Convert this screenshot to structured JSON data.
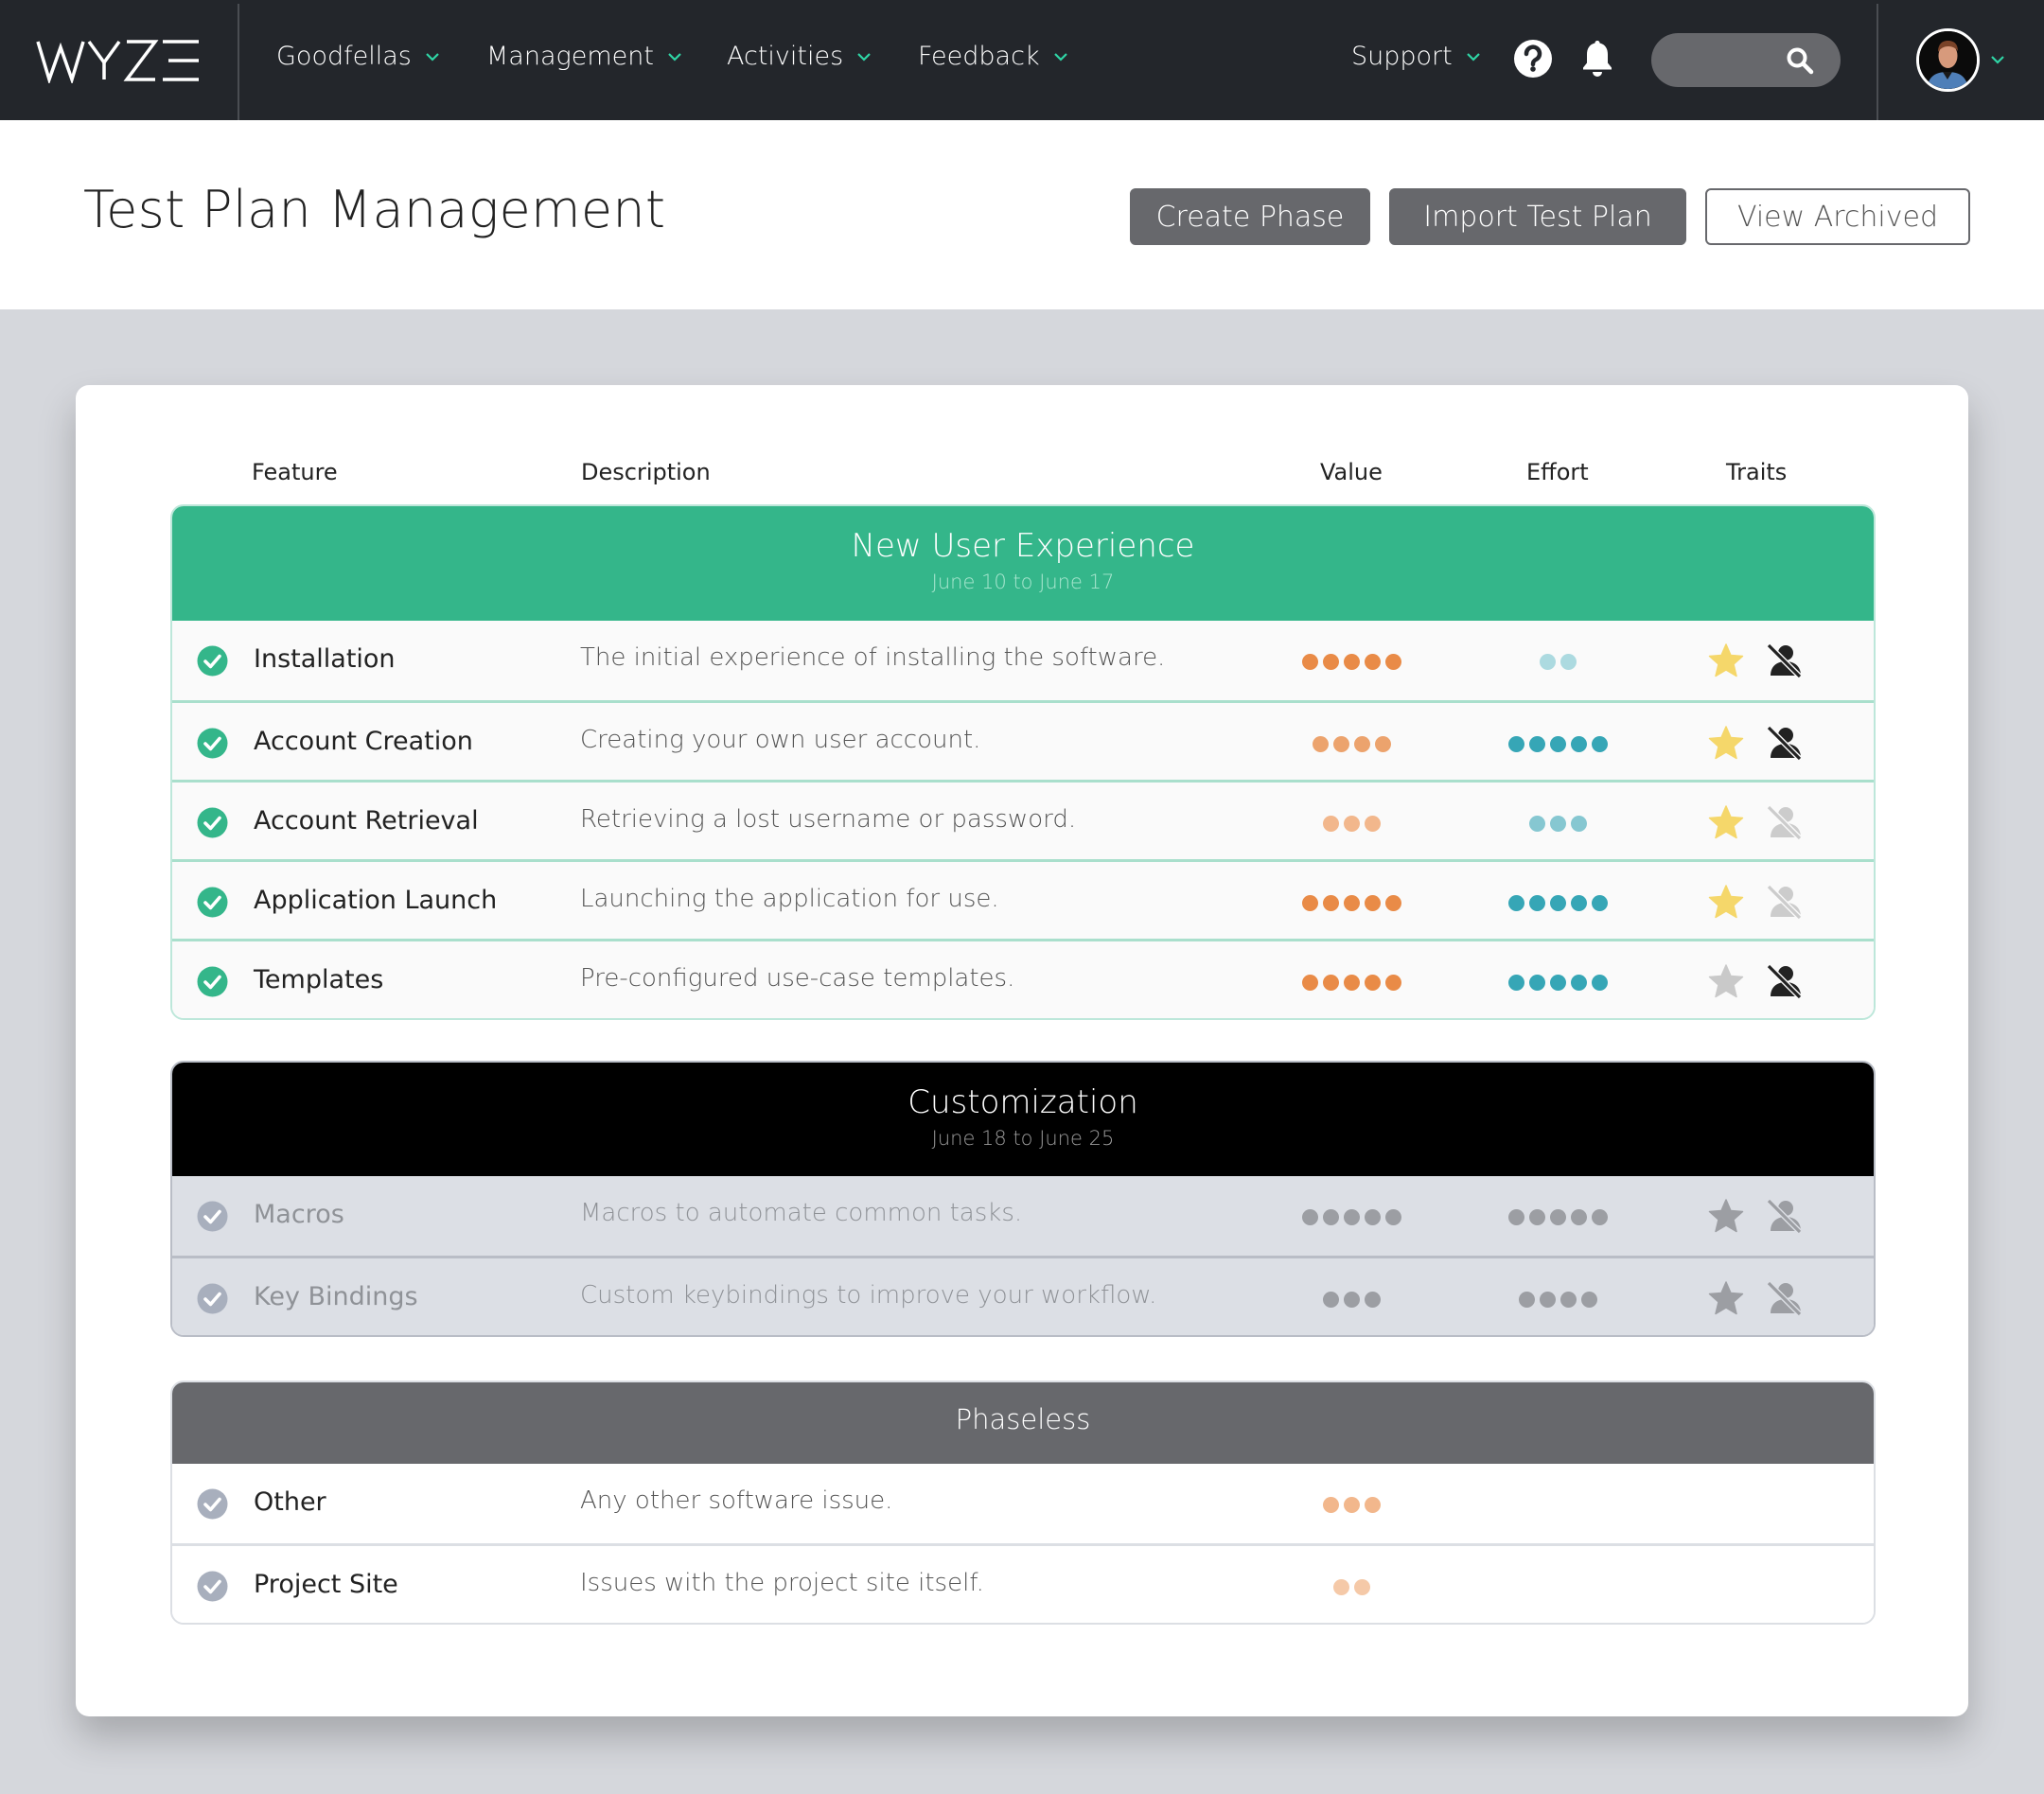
{
  "nav": {
    "logo": "WYZE",
    "items": [
      {
        "label": "Goodfellas"
      },
      {
        "label": "Management"
      },
      {
        "label": "Activities"
      },
      {
        "label": "Feedback"
      }
    ],
    "support_label": "Support",
    "search_placeholder": "",
    "accent_color": "#2fd6a6"
  },
  "page": {
    "title": "Test Plan Management",
    "buttons": {
      "create_phase": "Create Phase",
      "import_test_plan": "Import Test Plan",
      "view_archived": "View Archived"
    }
  },
  "table": {
    "columns": {
      "feature": "Feature",
      "description": "Description",
      "value": "Value",
      "effort": "Effort",
      "traits": "Traits"
    },
    "sections": [
      {
        "title": "New User Experience",
        "dates": "June 10 to June 17",
        "header_color": "#34b68a",
        "state": "active",
        "rows": [
          {
            "feature": "Installation",
            "description": "The initial experience of installing the software.",
            "value": 5,
            "effort": 2,
            "starred": true,
            "user_excluded": true
          },
          {
            "feature": "Account Creation",
            "description": "Creating your own user account.",
            "value": 4,
            "effort": 5,
            "starred": true,
            "user_excluded": true
          },
          {
            "feature": "Account Retrieval",
            "description": "Retrieving a lost username or password.",
            "value": 3,
            "effort": 3,
            "starred": true,
            "user_excluded": false
          },
          {
            "feature": "Application Launch",
            "description": "Launching the application for use.",
            "value": 5,
            "effort": 5,
            "starred": true,
            "user_excluded": false
          },
          {
            "feature": "Templates",
            "description": "Pre-configured use-case templates.",
            "value": 5,
            "effort": 5,
            "starred": false,
            "user_excluded": true
          }
        ]
      },
      {
        "title": "Customization",
        "dates": "June 18 to June 25",
        "header_color": "#000000",
        "state": "disabled",
        "rows": [
          {
            "feature": "Macros",
            "description": "Macros to automate common tasks.",
            "value": 5,
            "effort": 5,
            "starred": false,
            "user_excluded": false
          },
          {
            "feature": "Key Bindings",
            "description": "Custom keybindings to improve your workflow.",
            "value": 3,
            "effort": 4,
            "starred": false,
            "user_excluded": false
          }
        ]
      },
      {
        "title": "Phaseless",
        "dates": "",
        "header_color": "#67686c",
        "state": "phaseless",
        "rows": [
          {
            "feature": "Other",
            "description": "Any other software issue.",
            "value": 3,
            "effort": null
          },
          {
            "feature": "Project Site",
            "description": "Issues with the project site itself.",
            "value": 2,
            "effort": null
          }
        ]
      }
    ]
  },
  "colors": {
    "value_dot": "#e98b47",
    "effort_dot": "#36a6b6",
    "star_on": "#f5d76a",
    "check_active": "#34b68a",
    "check_inactive": "#a8afbd"
  }
}
